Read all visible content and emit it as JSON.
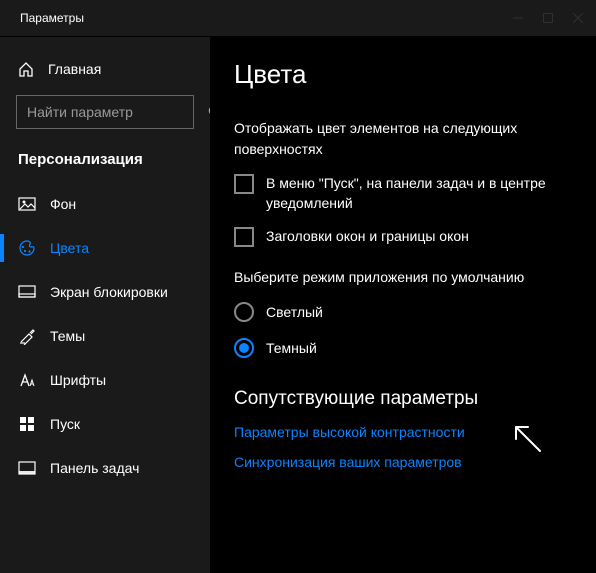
{
  "window_title": "Параметры",
  "colors": {
    "bg": "#000000",
    "sidebar": "#1a1a1a",
    "accent": "#0a84ff",
    "text": "#ffffff",
    "muted": "#888888"
  },
  "home_label": "Главная",
  "search": {
    "placeholder": "Найти параметр"
  },
  "category": "Персонализация",
  "nav": [
    {
      "id": "background",
      "label": "Фон",
      "icon": "picture-icon",
      "active": false
    },
    {
      "id": "colors",
      "label": "Цвета",
      "icon": "palette-icon",
      "active": true
    },
    {
      "id": "lockscreen",
      "label": "Экран блокировки",
      "icon": "lockscreen-icon",
      "active": false
    },
    {
      "id": "themes",
      "label": "Темы",
      "icon": "themes-icon",
      "active": false
    },
    {
      "id": "fonts",
      "label": "Шрифты",
      "icon": "fonts-icon",
      "active": false
    },
    {
      "id": "start",
      "label": "Пуск",
      "icon": "start-icon",
      "active": false
    },
    {
      "id": "taskbar",
      "label": "Панель задач",
      "icon": "taskbar-icon",
      "active": false
    }
  ],
  "page": {
    "title": "Цвета",
    "surfaces_intro": "Отображать цвет элементов на следующих поверхностях",
    "checkboxes": [
      {
        "id": "start-taskbar-ac",
        "label": "В меню \"Пуск\", на панели задач и в центре уведомлений",
        "checked": false
      },
      {
        "id": "title-borders",
        "label": "Заголовки окон и границы окон",
        "checked": false
      }
    ],
    "mode_label": "Выберите режим приложения по умолчанию",
    "mode_options": [
      {
        "id": "light",
        "label": "Светлый",
        "selected": false
      },
      {
        "id": "dark",
        "label": "Темный",
        "selected": true
      }
    ],
    "related_heading": "Сопутствующие параметры",
    "related_links": [
      {
        "id": "high-contrast",
        "label": "Параметры высокой контрастности"
      },
      {
        "id": "sync",
        "label": "Синхронизация ваших параметров"
      }
    ]
  }
}
